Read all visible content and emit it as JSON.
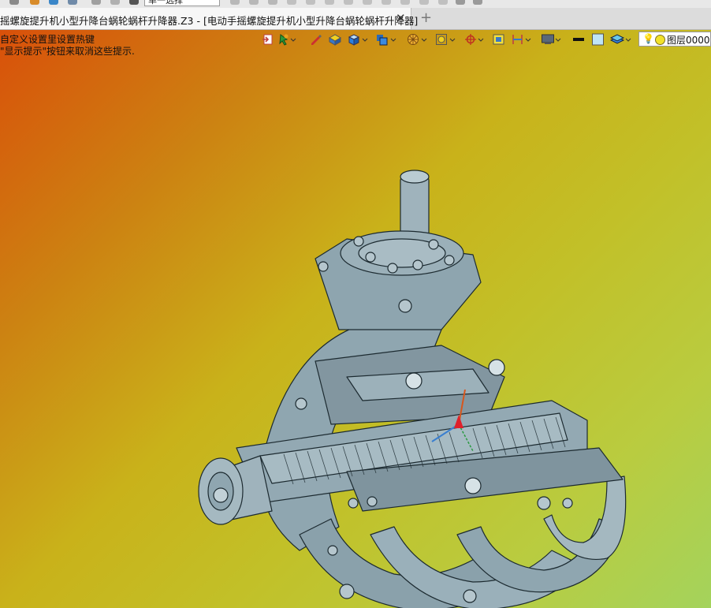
{
  "quick_toolbar": {
    "filter_combo": "单一选择"
  },
  "tab": {
    "title": "摇螺旋提升机小型升降台蜗轮蜗杆升降器.Z3 - [电动手摇螺旋提升机小型升降台蜗轮蜗杆升降器]",
    "close": "✕",
    "new": "+"
  },
  "hints": {
    "line1": "自定义设置里设置热键",
    "line2": "\"显示提示\"按钮来取消这些提示."
  },
  "layer": {
    "bulb": "💡",
    "name": "图层0000"
  },
  "colors": {
    "part_fill": "#8fa6b0",
    "part_edge": "#1c2a30",
    "axis_x": "#d8561c",
    "axis_y": "#3a7fd0",
    "axis_z": "#e0202a"
  }
}
